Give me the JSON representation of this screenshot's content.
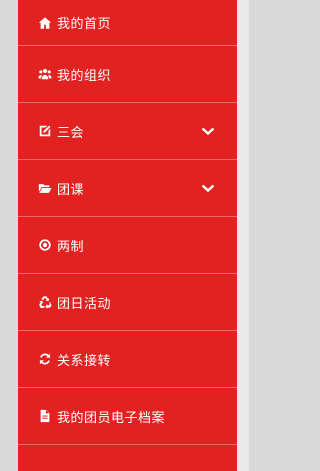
{
  "sidebar": {
    "items": [
      {
        "label": "我的首页",
        "icon": "home-icon"
      },
      {
        "label": "我的组织",
        "icon": "users-icon"
      },
      {
        "label": "三会",
        "icon": "edit-icon",
        "expandable": true
      },
      {
        "label": "团课",
        "icon": "folder-open-icon",
        "expandable": true
      },
      {
        "label": "两制",
        "icon": "radio-icon"
      },
      {
        "label": "团日活动",
        "icon": "recycle-icon"
      },
      {
        "label": "关系接转",
        "icon": "refresh-icon"
      },
      {
        "label": "我的团员电子档案",
        "icon": "file-icon"
      }
    ]
  },
  "colors": {
    "sidebar_bg": "#e12220",
    "text": "#ffffff",
    "page_bg": "#d9d9d9"
  }
}
